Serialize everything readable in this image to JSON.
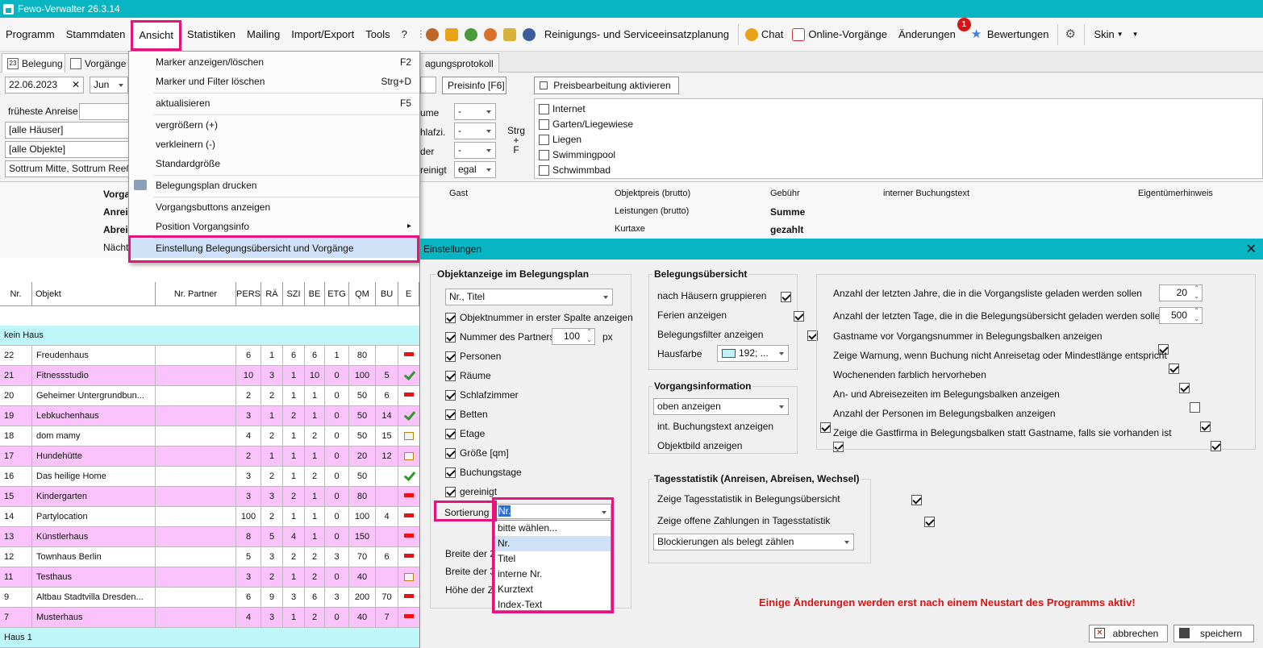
{
  "window": {
    "title": "Fewo-Verwalter 26.3.14"
  },
  "menubar": {
    "items": [
      "Programm",
      "Stammdaten",
      "Ansicht",
      "Statistiken",
      "Mailing",
      "Import/Export",
      "Tools",
      "?"
    ],
    "links": {
      "cleaning": "Reinigungs- und Serviceeinsatzplanung",
      "chat": "Chat",
      "online": "Online-Vorgänge",
      "changes": "Änderungen",
      "changes_badge": "1",
      "ratings": "Bewertungen",
      "skin": "Skin"
    }
  },
  "tabs": [
    "Belegung",
    "Vorgänge",
    "agungsprotokoll"
  ],
  "filters": {
    "date": "22.06.2023",
    "month": "Jun",
    "earliest_label": "früheste Anreise",
    "houses": "[alle Häuser]",
    "objects": "[alle Objekte]",
    "location": "Sottrum Mitte, Sottrum Reeßun",
    "preisinfo": "Preisinfo [F6]",
    "preisbearbeitung": "Preisbearbeitung aktivieren",
    "mid_labels": [
      "ume",
      "hlafzi.",
      "der",
      "reinigt"
    ],
    "mid_values": [
      "-",
      "-",
      "-",
      "egal"
    ],
    "strg": "Strg\n+\nF",
    "features": [
      "Internet",
      "Garten/Liegewiese",
      "Liegen",
      "Swimmingpool",
      "Schwimmbad"
    ]
  },
  "info": {
    "left": [
      "Vorga",
      "Anreis",
      "Abreis",
      "Nächt"
    ],
    "gast": "Gast",
    "objektpreis": "Objektpreis (brutto)",
    "leistungen": "Leistungen (brutto)",
    "kurtaxe": "Kurtaxe",
    "gebuehr": "Gebühr",
    "summe": "Summe",
    "gezahlt": "gezahlt",
    "interner": "interner Buchungstext",
    "eigentuemer": "Eigentümerhinweis"
  },
  "grid": {
    "headers": [
      "Nr.",
      "Objekt",
      "Nr. Partner",
      "PERS",
      "RÄ",
      "SZI",
      "BE",
      "ETG",
      "QM",
      "BU",
      "E"
    ],
    "group1": "kein Haus",
    "group2": "Haus 1",
    "rows": [
      {
        "nr": "22",
        "obj": "Freudenhaus",
        "pers": "6",
        "ra": "1",
        "szi": "6",
        "be": "6",
        "etg": "1",
        "qm": "80",
        "bu": "",
        "e": "red",
        "pink": false
      },
      {
        "nr": "21",
        "obj": "Fitnessstudio",
        "pers": "10",
        "ra": "3",
        "szi": "1",
        "be": "10",
        "etg": "0",
        "qm": "100",
        "bu": "5",
        "e": "ok",
        "pink": true
      },
      {
        "nr": "20",
        "obj": "Geheimer Untergrundbun...",
        "pers": "2",
        "ra": "2",
        "szi": "1",
        "be": "1",
        "etg": "0",
        "qm": "50",
        "bu": "6",
        "e": "red",
        "pink": false
      },
      {
        "nr": "19",
        "obj": "Lebkuchenhaus",
        "pers": "3",
        "ra": "1",
        "szi": "2",
        "be": "1",
        "etg": "0",
        "qm": "50",
        "bu": "14",
        "e": "ok",
        "pink": true
      },
      {
        "nr": "18",
        "obj": "dom mamy",
        "pers": "4",
        "ra": "2",
        "szi": "1",
        "be": "2",
        "etg": "0",
        "qm": "50",
        "bu": "15",
        "e": "cal",
        "pink": false
      },
      {
        "nr": "17",
        "obj": "Hundehütte",
        "pers": "2",
        "ra": "1",
        "szi": "1",
        "be": "1",
        "etg": "0",
        "qm": "20",
        "bu": "12",
        "e": "cal",
        "pink": true
      },
      {
        "nr": "16",
        "obj": "Das heilige Home",
        "pers": "3",
        "ra": "2",
        "szi": "1",
        "be": "2",
        "etg": "0",
        "qm": "50",
        "bu": "",
        "e": "ok",
        "pink": false
      },
      {
        "nr": "15",
        "obj": "Kindergarten",
        "pers": "3",
        "ra": "3",
        "szi": "2",
        "be": "1",
        "etg": "0",
        "qm": "80",
        "bu": "",
        "e": "red",
        "pink": true
      },
      {
        "nr": "14",
        "obj": "Partylocation",
        "pers": "100",
        "ra": "2",
        "szi": "1",
        "be": "1",
        "etg": "0",
        "qm": "100",
        "bu": "4",
        "e": "red",
        "pink": false
      },
      {
        "nr": "13",
        "obj": "Künstlerhaus",
        "pers": "8",
        "ra": "5",
        "szi": "4",
        "be": "1",
        "etg": "0",
        "qm": "150",
        "bu": "",
        "e": "red",
        "pink": true
      },
      {
        "nr": "12",
        "obj": "Townhaus Berlin",
        "pers": "5",
        "ra": "3",
        "szi": "2",
        "be": "2",
        "etg": "3",
        "qm": "70",
        "bu": "6",
        "e": "red",
        "pink": false
      },
      {
        "nr": "11",
        "obj": "Testhaus",
        "pers": "3",
        "ra": "2",
        "szi": "1",
        "be": "2",
        "etg": "0",
        "qm": "40",
        "bu": "",
        "e": "cal",
        "pink": true
      },
      {
        "nr": "9",
        "obj": "Altbau Stadtvilla Dresden...",
        "pers": "6",
        "ra": "9",
        "szi": "3",
        "be": "6",
        "etg": "3",
        "qm": "200",
        "bu": "70",
        "e": "red",
        "pink": false
      },
      {
        "nr": "7",
        "obj": "Musterhaus",
        "pers": "4",
        "ra": "3",
        "szi": "1",
        "be": "2",
        "etg": "0",
        "qm": "40",
        "bu": "7",
        "e": "red",
        "pink": true
      }
    ]
  },
  "ansicht_menu": [
    {
      "label": "Marker anzeigen/löschen",
      "shortcut": "F2"
    },
    {
      "label": "Marker und Filter löschen",
      "shortcut": "Strg+D"
    },
    {
      "label": "aktualisieren",
      "shortcut": "F5"
    },
    {
      "label": "vergrößern (+)",
      "shortcut": ""
    },
    {
      "label": "verkleinern (-)",
      "shortcut": ""
    },
    {
      "label": "Standardgröße",
      "shortcut": ""
    },
    {
      "label": "Belegungsplan drucken",
      "shortcut": ""
    },
    {
      "label": "Vorgangsbuttons anzeigen",
      "shortcut": ""
    },
    {
      "label": "Position Vorgangsinfo",
      "shortcut": "▸"
    },
    {
      "label": "Einstellung Belegungsübersicht und Vorgänge",
      "shortcut": ""
    }
  ],
  "dialog": {
    "title": "Einstellungen",
    "obj": {
      "title": "Objektanzeige im Belegungsplan",
      "select": "Nr., Titel",
      "checks": [
        "Objektnummer in erster Spalte anzeigen",
        "Nummer des Partners",
        "Personen",
        "Räume",
        "Schlafzimmer",
        "Betten",
        "Etage",
        "Größe [qm]",
        "Buchungstage",
        "gereinigt"
      ],
      "partner_width": "100",
      "px": "px",
      "sort_label": "Sortierung",
      "sort_value": "Nr.",
      "breite2": "Breite der 2.",
      "breite3": "Breite der 3.",
      "hoehe": "Höhe der Ze",
      "sort_options": [
        "bitte wählen...",
        "Nr.",
        "Titel",
        "interne Nr.",
        "Kurztext",
        "Index-Text"
      ]
    },
    "bel": {
      "title": "Belegungsübersicht",
      "checks": [
        "nach Häusern gruppieren",
        "Ferien anzeigen",
        "Belegungsfilter anzeigen"
      ],
      "hausfarbe_label": "Hausfarbe",
      "hausfarbe_value": "192; ..."
    },
    "vorg": {
      "title": "Vorgangsinformation",
      "select": "oben anzeigen",
      "checks": [
        "int. Buchungstext anzeigen",
        "Objektbild anzeigen"
      ]
    },
    "tages": {
      "title": "Tagesstatistik (Anreisen, Abreisen, Wechsel)",
      "checks": [
        "Zeige Tagesstatistik in Belegungsübersicht",
        "Zeige offene Zahlungen in Tagesstatistik"
      ],
      "select": "Blockierungen als belegt zählen"
    },
    "right": {
      "years_label": "Anzahl der letzten Jahre, die in die Vorgangsliste geladen werden sollen",
      "years": "20",
      "days_label": "Anzahl der letzten Tage, die in die Belegungsübersicht geladen werden sollen",
      "days": "500",
      "checks": [
        {
          "label": "Gastname vor Vorgangsnummer in Belegungsbalken anzeigen",
          "on": true
        },
        {
          "label": "Zeige Warnung, wenn Buchung nicht Anreisetag oder Mindestlänge entspricht",
          "on": true
        },
        {
          "label": "Wochenenden farblich hervorheben",
          "on": true
        },
        {
          "label": "An- und Abreisezeiten im Belegungsbalken anzeigen",
          "on": false
        },
        {
          "label": "Anzahl der Personen im Belegungsbalken anzeigen",
          "on": true
        },
        {
          "label": "Zeige die Gastfirma in Belegungsbalken statt Gastname, falls sie vorhanden ist",
          "on": true
        }
      ]
    },
    "warning": "Einige Änderungen werden erst nach einem Neustart des Programms aktiv!",
    "cancel": "abbrechen",
    "save": "speichern"
  },
  "colors": {
    "accent": "#07b6c2",
    "highlight": "#e4147c",
    "pinkrow": "#fbc3fb",
    "cyanrow": "#bff6fa",
    "warning": "#e01010"
  }
}
